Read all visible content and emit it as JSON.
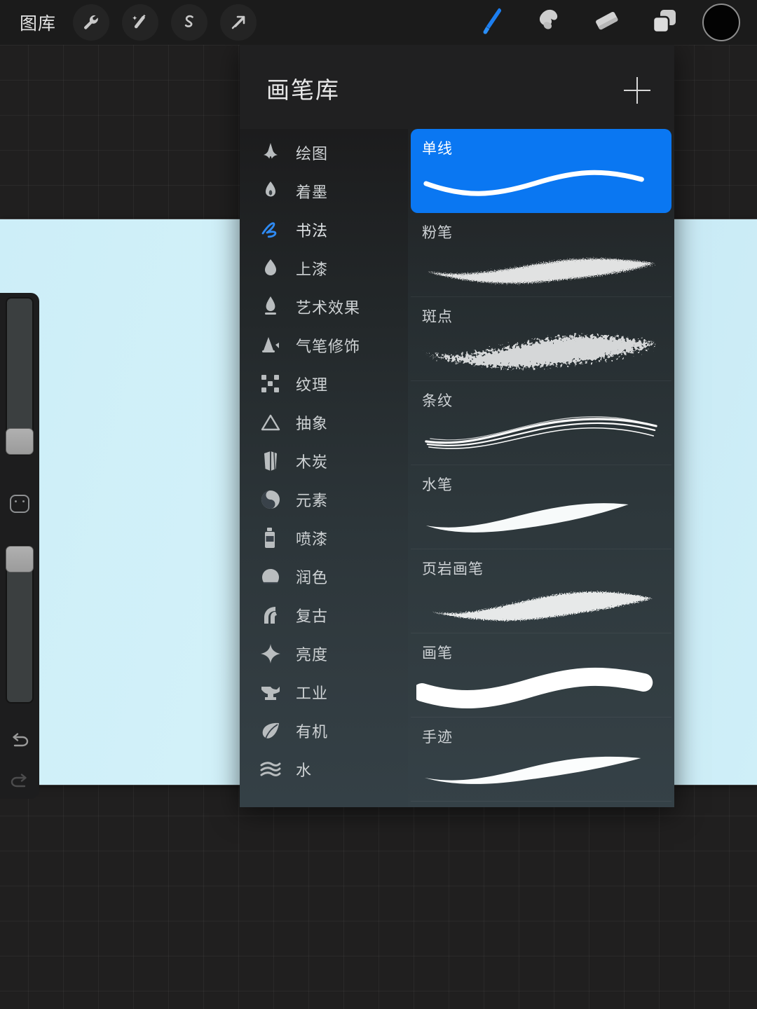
{
  "app": {
    "name": "procreate-brush-library",
    "accent_blue": "#0A77F2",
    "panel_bg": "#1E1E1F",
    "canvas_color": "#CFEFF8",
    "toolbar_bg": "#1B1B1B"
  },
  "toolbar": {
    "gallery_label": "图库",
    "left_tools": [
      {
        "name": "wrench-icon",
        "label": "操作"
      },
      {
        "name": "magic-wand-icon",
        "label": "调整"
      },
      {
        "name": "selection-s-icon",
        "label": "选取"
      },
      {
        "name": "arrow-transform-icon",
        "label": "变换"
      }
    ],
    "right_tools": [
      {
        "name": "paintbrush-icon",
        "label": "绘图",
        "active": true
      },
      {
        "name": "smudge-icon",
        "label": "涂抹",
        "active": false
      },
      {
        "name": "eraser-icon",
        "label": "擦除",
        "active": false
      },
      {
        "name": "layers-icon",
        "label": "图层",
        "active": false
      }
    ],
    "color_swatch": {
      "name": "color-swatch",
      "value": "#030303"
    }
  },
  "sidebar": {
    "size_slider": {
      "label": "笔刷大小",
      "value": 6
    },
    "opacity_slider": {
      "label": "不透明度",
      "value": 97
    },
    "modify_button": {
      "label": "修改"
    },
    "undo_button": {
      "label": "撤销"
    },
    "redo_button": {
      "label": "重做",
      "disabled": true
    }
  },
  "panel": {
    "title": "画笔库",
    "add_button_label": "+",
    "categories": [
      {
        "label": "绘图",
        "icon": "sketching-icon",
        "selected": false
      },
      {
        "label": "着墨",
        "icon": "inking-pen-icon",
        "selected": false
      },
      {
        "label": "书法",
        "icon": "calligraphy-icon",
        "selected": true
      },
      {
        "label": "上漆",
        "icon": "painting-drop-icon",
        "selected": false
      },
      {
        "label": "艺术效果",
        "icon": "artistic-icon",
        "selected": false
      },
      {
        "label": "气笔修饰",
        "icon": "airbrushing-icon",
        "selected": false
      },
      {
        "label": "纹理",
        "icon": "textures-icon",
        "selected": false
      },
      {
        "label": "抽象",
        "icon": "abstract-icon",
        "selected": false
      },
      {
        "label": "木炭",
        "icon": "charcoal-icon",
        "selected": false
      },
      {
        "label": "元素",
        "icon": "elements-yinyang-icon",
        "selected": false
      },
      {
        "label": "喷漆",
        "icon": "spraypaint-icon",
        "selected": false
      },
      {
        "label": "润色",
        "icon": "retro-shell-icon",
        "selected": false
      },
      {
        "label": "复古",
        "icon": "vintage-icon",
        "selected": false
      },
      {
        "label": "亮度",
        "icon": "luminance-spark-icon",
        "selected": false
      },
      {
        "label": "工业",
        "icon": "industrial-anvil-icon",
        "selected": false
      },
      {
        "label": "有机",
        "icon": "organic-leaf-icon",
        "selected": false
      },
      {
        "label": "水",
        "icon": "water-waves-icon",
        "selected": false
      }
    ],
    "brushes": [
      {
        "label": "单线",
        "stroke": "monoline",
        "selected": true
      },
      {
        "label": "粉笔",
        "stroke": "chalk",
        "selected": false
      },
      {
        "label": "斑点",
        "stroke": "mottled",
        "selected": false
      },
      {
        "label": "条纹",
        "stroke": "streaks",
        "selected": false
      },
      {
        "label": "水笔",
        "stroke": "waterpen",
        "selected": false
      },
      {
        "label": "页岩画笔",
        "stroke": "shale",
        "selected": false
      },
      {
        "label": "画笔",
        "stroke": "brush",
        "selected": false
      },
      {
        "label": "手迹",
        "stroke": "handwriting",
        "selected": false
      }
    ]
  }
}
